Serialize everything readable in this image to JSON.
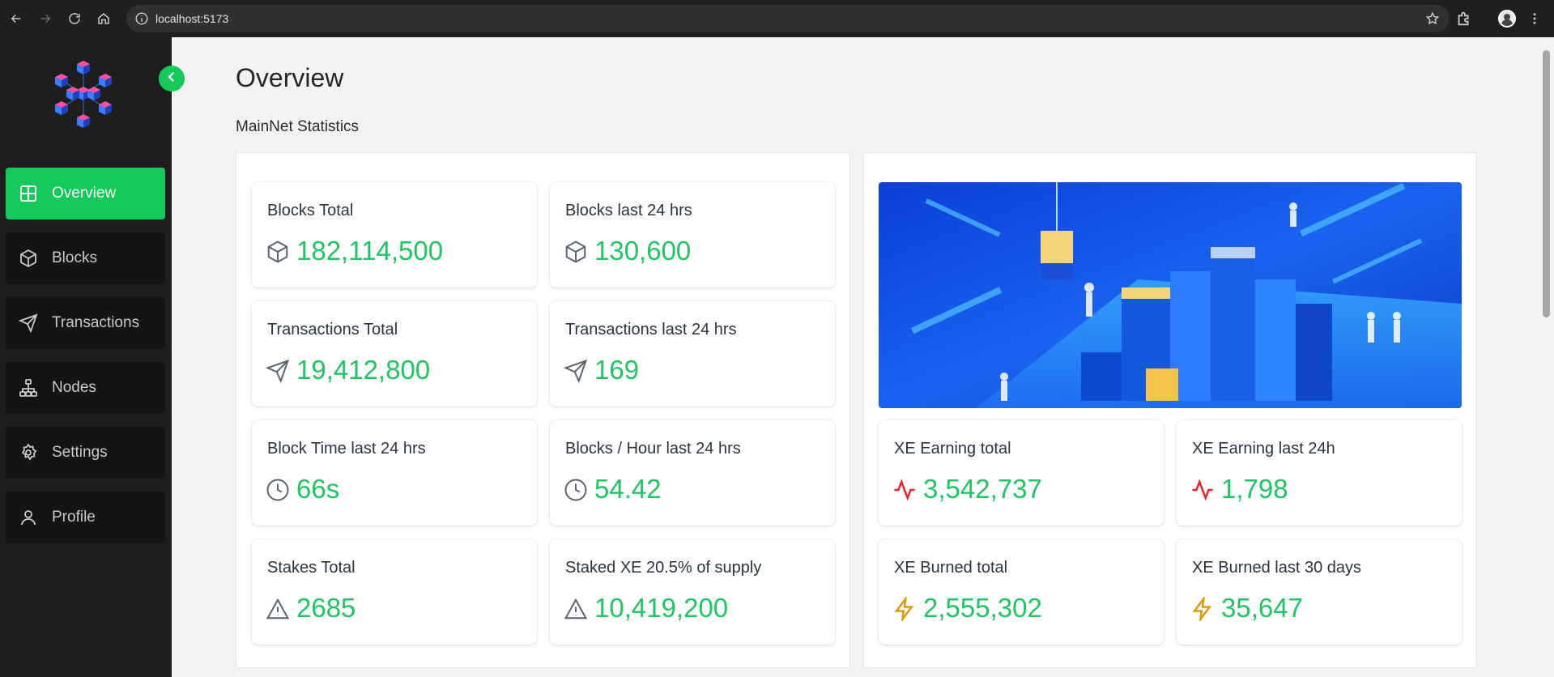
{
  "browser": {
    "url": "localhost:5173"
  },
  "sidebar": {
    "items": [
      {
        "label": "Overview",
        "icon": "grid-icon",
        "active": true
      },
      {
        "label": "Blocks",
        "icon": "cube-icon",
        "active": false
      },
      {
        "label": "Transactions",
        "icon": "send-icon",
        "active": false
      },
      {
        "label": "Nodes",
        "icon": "network-icon",
        "active": false
      },
      {
        "label": "Settings",
        "icon": "gear-icon",
        "active": false
      },
      {
        "label": "Profile",
        "icon": "user-icon",
        "active": false
      }
    ]
  },
  "main": {
    "title": "Overview",
    "subtitle": "MainNet Statistics",
    "left_cards": [
      {
        "label": "Blocks Total",
        "value": "182,114,500",
        "icon": "cube-icon"
      },
      {
        "label": "Blocks last 24 hrs",
        "value": "130,600",
        "icon": "cube-icon"
      },
      {
        "label": "Transactions Total",
        "value": "19,412,800",
        "icon": "send-icon"
      },
      {
        "label": "Transactions last 24 hrs",
        "value": "169",
        "icon": "send-icon"
      },
      {
        "label": "Block Time last 24 hrs",
        "value": "66s",
        "icon": "clock-icon"
      },
      {
        "label": "Blocks / Hour last 24 hrs",
        "value": "54.42",
        "icon": "clock-icon"
      },
      {
        "label": "Stakes Total",
        "value": "2685",
        "icon": "warning-icon"
      },
      {
        "label": "Staked XE 20.5% of supply",
        "value": "10,419,200",
        "icon": "warning-icon"
      }
    ],
    "right_cards": [
      {
        "label": "XE Earning total",
        "value": "3,542,737",
        "icon": "activity-icon"
      },
      {
        "label": "XE Earning last 24h",
        "value": "1,798",
        "icon": "activity-icon"
      },
      {
        "label": "XE Burned total",
        "value": "2,555,302",
        "icon": "lightning-icon"
      },
      {
        "label": "XE Burned last 30 days",
        "value": "35,647",
        "icon": "lightning-icon"
      }
    ]
  },
  "colors": {
    "accent": "#12c95a",
    "value_green": "#1fc463",
    "activity_red": "#e0262b",
    "lightning_amber": "#d99a0e",
    "icon_gray": "#5b6472"
  }
}
